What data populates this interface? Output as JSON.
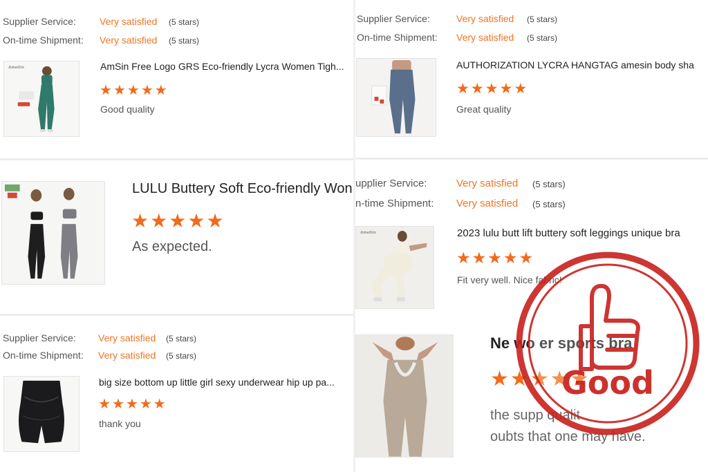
{
  "colors": {
    "accent": "#f07423",
    "star": "#f26a1b",
    "stamp": "#c8201c"
  },
  "reviews": [
    {
      "supplier_label": "Supplier Service:",
      "supplier_value": "Very satisfied",
      "supplier_stars": "(5 stars)",
      "shipment_label": "On-time Shipment:",
      "shipment_value": "Very satisfied",
      "shipment_stars": "(5 stars)",
      "title": "AmSin Free Logo GRS Eco-friendly Lycra Women Tigh...",
      "rating": 5,
      "comment": "Good quality"
    },
    {
      "title": "LULU Buttery Soft Eco-friendly Won",
      "rating": 5,
      "comment": "As expected."
    },
    {
      "supplier_label": "Supplier Service:",
      "supplier_value": "Very satisfied",
      "supplier_stars": "(5 stars)",
      "shipment_label": "On-time Shipment:",
      "shipment_value": "Very satisfied",
      "shipment_stars": "(5 stars)",
      "title": "big size bottom up little girl sexy underwear hip up pa...",
      "rating": 5,
      "comment": "thank you"
    },
    {
      "supplier_label": "Supplier Service:",
      "supplier_value": "Very satisfied",
      "supplier_stars": "(5 stars)",
      "shipment_label": "On-time Shipment:",
      "shipment_value": "Very satisfied",
      "shipment_stars": "(5 stars)",
      "title": "AUTHORIZATION LYCRA HANGTAG amesin body sha",
      "rating": 5,
      "comment": "Great quality"
    },
    {
      "supplier_label": "upplier Service:",
      "supplier_value": "Very satisfied",
      "supplier_stars": "(5 stars)",
      "shipment_label": "n-time Shipment:",
      "shipment_value": "Very satisfied",
      "shipment_stars": "(5 stars)",
      "title": "2023 lulu butt lift buttery soft leggings unique bra",
      "rating": 5,
      "comment": "Fit very well. Nice fabric!"
    },
    {
      "title": "Ne  wo er  sports bra",
      "rating": 5,
      "comment_line1": "the supp          qualit",
      "comment_line2": "oubts that one may have."
    }
  ],
  "stamp": {
    "text": "Good",
    "icon": "thumbs-up-icon"
  },
  "icons": {
    "star": "star-icon"
  }
}
